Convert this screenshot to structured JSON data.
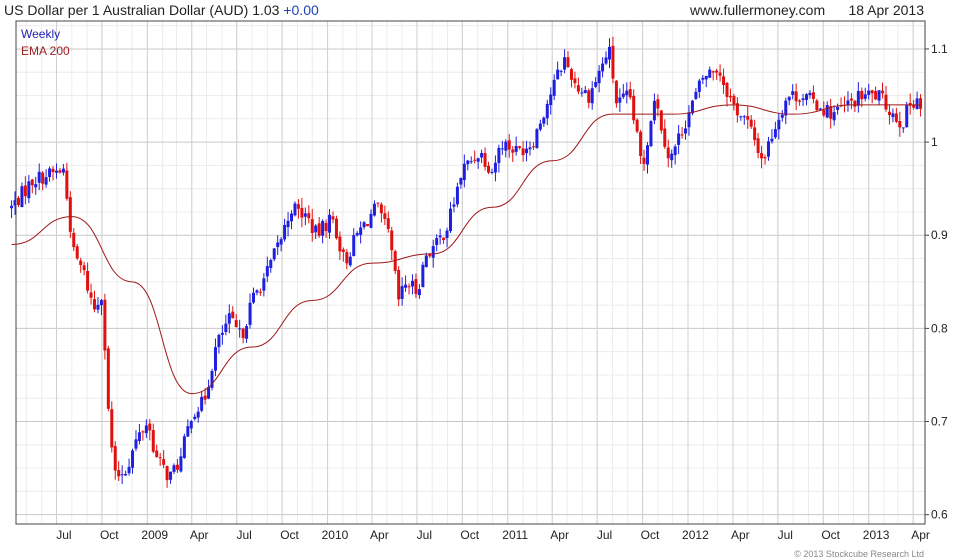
{
  "header": {
    "title": "US Dollar per 1 Australian Dollar (AUD)",
    "price": "1.03",
    "change": "+0.00",
    "site": "www.fullermoney.com",
    "date": "18 Apr 2013"
  },
  "legend": {
    "weekly": "Weekly",
    "ema": "EMA 200"
  },
  "copyright": "© 2013 Stockcube Research Ltd",
  "colors": {
    "up": "#1f1fe0",
    "down": "#e01010",
    "ema": "#a01818",
    "grid": "#d8d8d8",
    "frame": "#444444"
  },
  "chart_data": {
    "type": "candlestick",
    "title": "US Dollar per 1 Australian Dollar (AUD)",
    "period": "Weekly",
    "ylim": [
      0.59,
      1.13
    ],
    "y_ticks": [
      0.6,
      0.7,
      0.8,
      0.9,
      1,
      1.1
    ],
    "y_tick_labels": [
      "0.6",
      "0.7",
      "0.8",
      "0.9",
      "1",
      "1.1"
    ],
    "x_ticks": [
      "Jul",
      "Oct",
      "2009",
      "Apr",
      "Jul",
      "Oct",
      "2010",
      "Apr",
      "Jul",
      "Oct",
      "2011",
      "Apr",
      "Jul",
      "Oct",
      "2012",
      "Apr",
      "Jul",
      "Oct",
      "2013",
      "Apr"
    ],
    "x_range_months": [
      "2008-04",
      "2013-04"
    ],
    "close_path": [
      [
        "2008-04-01",
        0.93
      ],
      [
        "2008-05-15",
        0.96
      ],
      [
        "2008-07-15",
        0.97
      ],
      [
        "2008-08-05",
        0.88
      ],
      [
        "2008-08-25",
        0.86
      ],
      [
        "2008-09-15",
        0.82
      ],
      [
        "2008-10-01",
        0.84
      ],
      [
        "2008-10-15",
        0.7
      ],
      [
        "2008-10-28",
        0.64
      ],
      [
        "2008-11-20",
        0.65
      ],
      [
        "2008-12-10",
        0.68
      ],
      [
        "2009-01-01",
        0.7
      ],
      [
        "2009-01-20",
        0.66
      ],
      [
        "2009-02-15",
        0.64
      ],
      [
        "2009-03-10",
        0.66
      ],
      [
        "2009-04-01",
        0.71
      ],
      [
        "2009-04-25",
        0.72
      ],
      [
        "2009-05-20",
        0.78
      ],
      [
        "2009-06-15",
        0.81
      ],
      [
        "2009-07-10",
        0.79
      ],
      [
        "2009-08-01",
        0.83
      ],
      [
        "2009-09-01",
        0.86
      ],
      [
        "2009-10-01",
        0.9
      ],
      [
        "2009-10-20",
        0.93
      ],
      [
        "2009-11-20",
        0.92
      ],
      [
        "2009-12-10",
        0.9
      ],
      [
        "2010-01-10",
        0.92
      ],
      [
        "2010-02-05",
        0.87
      ],
      [
        "2010-03-01",
        0.9
      ],
      [
        "2010-04-10",
        0.93
      ],
      [
        "2010-05-05",
        0.9
      ],
      [
        "2010-05-25",
        0.83
      ],
      [
        "2010-06-10",
        0.85
      ],
      [
        "2010-07-01",
        0.84
      ],
      [
        "2010-07-20",
        0.88
      ],
      [
        "2010-08-10",
        0.89
      ],
      [
        "2010-09-01",
        0.91
      ],
      [
        "2010-10-01",
        0.97
      ],
      [
        "2010-11-05",
        0.99
      ],
      [
        "2010-11-30",
        0.97
      ],
      [
        "2010-12-20",
        1.0
      ],
      [
        "2011-01-20",
        0.99
      ],
      [
        "2011-02-20",
        1.0
      ],
      [
        "2011-03-20",
        1.04
      ],
      [
        "2011-04-25",
        1.09
      ],
      [
        "2011-05-20",
        1.06
      ],
      [
        "2011-06-15",
        1.05
      ],
      [
        "2011-07-25",
        1.1
      ],
      [
        "2011-08-10",
        1.04
      ],
      [
        "2011-09-05",
        1.05
      ],
      [
        "2011-10-01",
        0.97
      ],
      [
        "2011-10-25",
        1.05
      ],
      [
        "2011-11-25",
        0.98
      ],
      [
        "2011-12-25",
        1.02
      ],
      [
        "2012-02-01",
        1.07
      ],
      [
        "2012-03-01",
        1.08
      ],
      [
        "2012-04-01",
        1.04
      ],
      [
        "2012-05-01",
        1.02
      ],
      [
        "2012-06-01",
        0.98
      ],
      [
        "2012-06-20",
        1.01
      ],
      [
        "2012-07-20",
        1.05
      ],
      [
        "2012-08-20",
        1.05
      ],
      [
        "2012-09-20",
        1.04
      ],
      [
        "2012-10-20",
        1.03
      ],
      [
        "2012-11-20",
        1.04
      ],
      [
        "2012-12-20",
        1.05
      ],
      [
        "2013-01-20",
        1.05
      ],
      [
        "2013-02-20",
        1.03
      ],
      [
        "2013-03-10",
        1.02
      ],
      [
        "2013-03-25",
        1.04
      ],
      [
        "2013-04-10",
        1.05
      ],
      [
        "2013-04-18",
        1.03
      ]
    ],
    "ema_path": [
      [
        "2008-04-01",
        0.89
      ],
      [
        "2008-08-01",
        0.92
      ],
      [
        "2008-12-01",
        0.85
      ],
      [
        "2009-04-01",
        0.73
      ],
      [
        "2009-08-01",
        0.78
      ],
      [
        "2009-12-01",
        0.83
      ],
      [
        "2010-04-01",
        0.87
      ],
      [
        "2010-08-01",
        0.88
      ],
      [
        "2010-12-01",
        0.93
      ],
      [
        "2011-04-01",
        0.98
      ],
      [
        "2011-08-01",
        1.03
      ],
      [
        "2011-12-01",
        1.03
      ],
      [
        "2012-04-01",
        1.04
      ],
      [
        "2012-08-01",
        1.03
      ],
      [
        "2012-12-01",
        1.04
      ],
      [
        "2013-04-18",
        1.04
      ]
    ]
  }
}
